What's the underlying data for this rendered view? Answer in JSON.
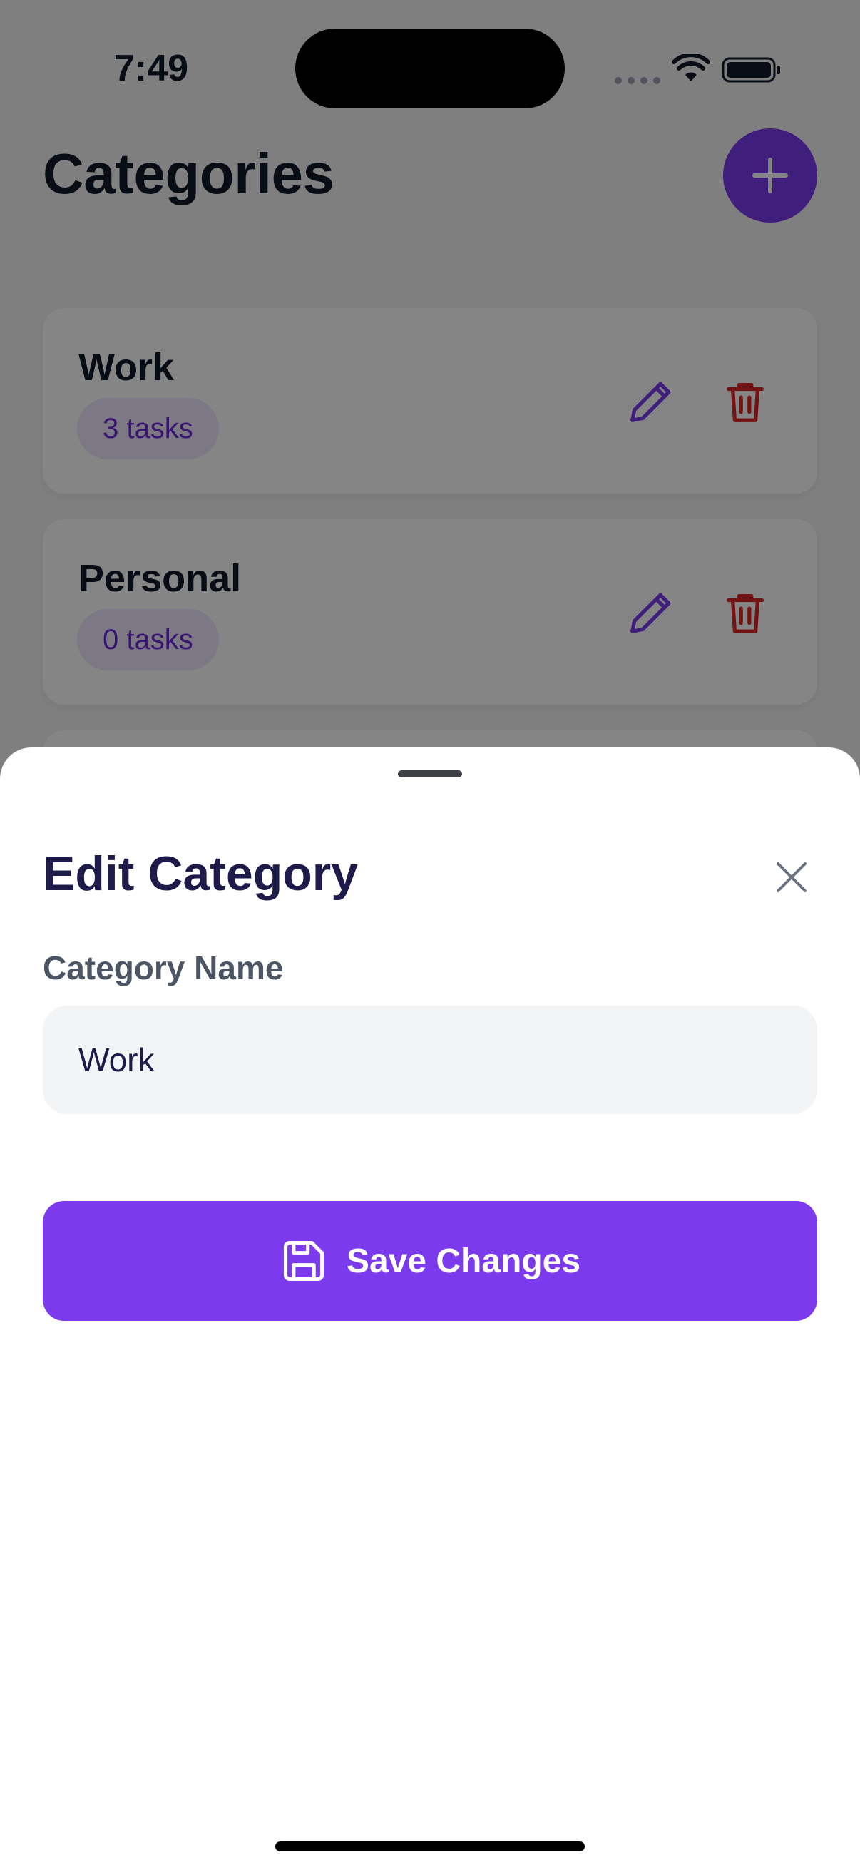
{
  "status_bar": {
    "time": "7:49"
  },
  "header": {
    "title": "Categories",
    "add_button_icon": "plus-icon"
  },
  "categories": [
    {
      "name": "Work",
      "count_label": "3 tasks"
    },
    {
      "name": "Personal",
      "count_label": "0 tasks"
    }
  ],
  "sheet": {
    "title": "Edit Category",
    "field_label": "Category Name",
    "input_value": "Work",
    "save_label": "Save Changes"
  },
  "colors": {
    "accent": "#7c3aed",
    "badge_bg": "#ede9fe",
    "danger": "#dc2626",
    "title_dark": "#1e1b4b"
  }
}
